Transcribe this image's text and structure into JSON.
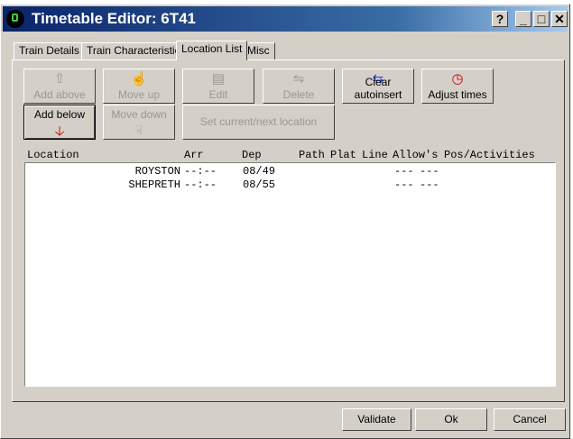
{
  "window": {
    "title": "Timetable Editor: 6T41"
  },
  "titlebar_buttons": {
    "help": "?",
    "minimize": "_",
    "maximize": "□",
    "close": "✕"
  },
  "tabs": [
    {
      "label": "Train Details"
    },
    {
      "label": "Train Characteristics"
    },
    {
      "label": "Location List"
    },
    {
      "label": "Misc"
    }
  ],
  "toolbar": {
    "add_above": "Add above",
    "move_up": "Move up",
    "edit": "Edit",
    "delete": "Delete",
    "clear_autoinsert": "Clear autoinsert",
    "adjust_times": "Adjust times",
    "add_below": "Add below",
    "move_down": "Move down",
    "set_current_next": "Set current/next location"
  },
  "columns": {
    "location": "Location",
    "arr": "Arr",
    "dep": "Dep",
    "path": "Path",
    "plat": "Plat",
    "line": "Line",
    "allows": "Allow's",
    "pos_activities": "Pos/Activities"
  },
  "rows": [
    {
      "location": "ROYSTON",
      "arr": "--:--",
      "dep": "08/49",
      "allows": "---",
      "pos": "---"
    },
    {
      "location": "SHEPRETH",
      "arr": "--:--",
      "dep": "08/55",
      "allows": "---",
      "pos": "---"
    }
  ],
  "footer": {
    "validate": "Validate",
    "ok": "Ok",
    "cancel": "Cancel"
  },
  "colors": {
    "title_start": "#0a246a",
    "title_end": "#a6caf0",
    "face": "#d4d0c8",
    "arrow_red": "#cc0000"
  }
}
